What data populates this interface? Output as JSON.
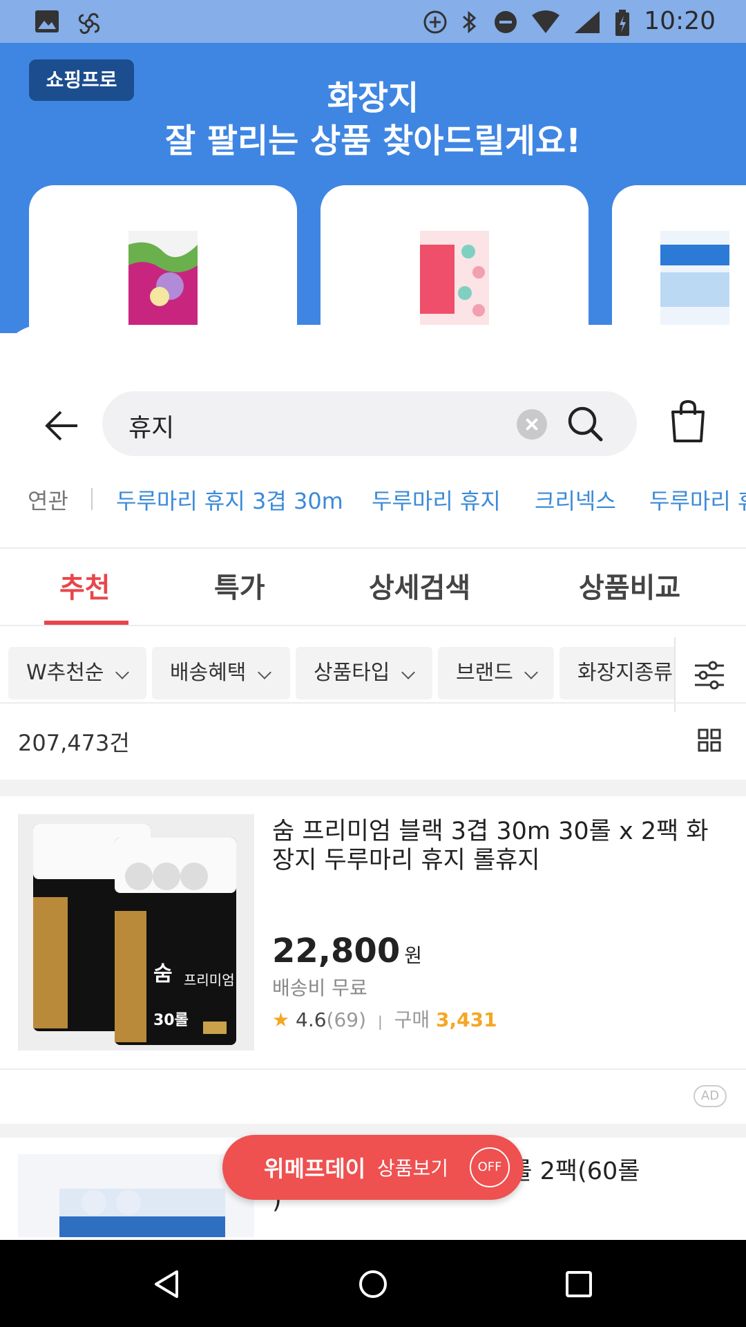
{
  "status_bar": {
    "time": "10:20"
  },
  "promo": {
    "badge": "쇼핑프로",
    "title_line1": "화장지",
    "title_line2": "잘 팔리는 상품 찾아드릴게요!"
  },
  "search": {
    "query": "휴지"
  },
  "related": {
    "label": "연관",
    "keywords": [
      "두루마리 휴지 3겹 30m",
      "두루마리 휴지",
      "크리넥스",
      "두루마리 휴"
    ]
  },
  "tabs": [
    "추천",
    "특가",
    "상세검색",
    "상품비교"
  ],
  "filters": [
    "W추천순",
    "배송혜택",
    "상품타입",
    "브랜드",
    "화장지종류"
  ],
  "result_count": "207,473건",
  "items": [
    {
      "title": "숨 프리미엄 블랙 3겹 30m 30롤 x 2팩 화장지 두루마리 휴지 롤휴지",
      "price": "22,800",
      "currency": "원",
      "shipping": "배송비 무료",
      "rating": "4.6",
      "reviews": "(69)",
      "buy_label": "구매",
      "buy_count": "3,431",
      "thumb_pack_label": "30롤",
      "thumb_brand": "숨",
      "thumb_sub": "프리미엄"
    },
    {
      "title_partial": "27m  30롤 2팩(60롤",
      "title_line2": ")"
    }
  ],
  "ad_label": "AD",
  "fab": {
    "brand": "위메프데이",
    "label": "상품보기",
    "toggle": "OFF"
  }
}
